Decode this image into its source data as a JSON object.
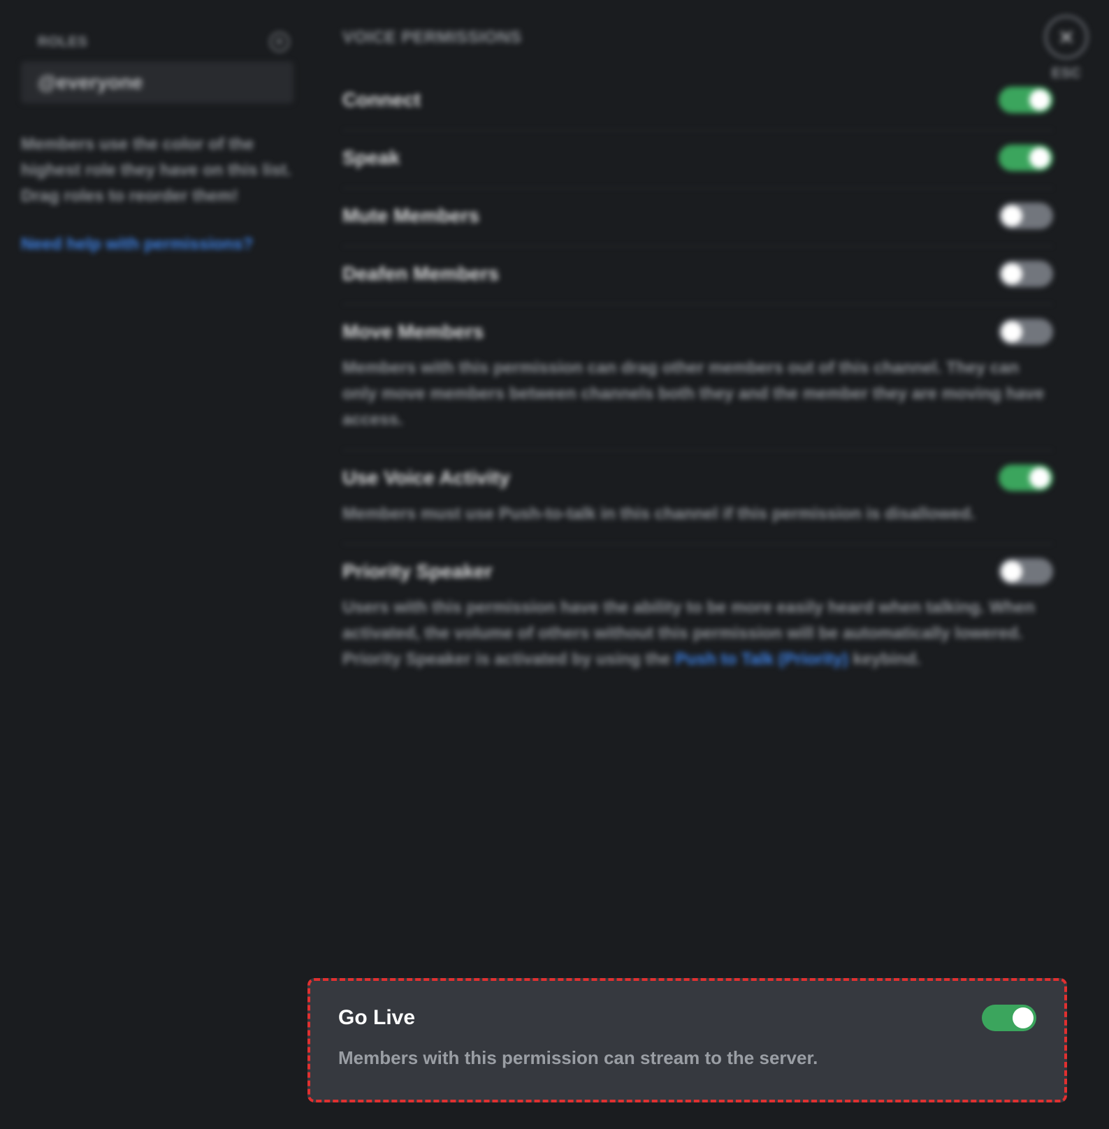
{
  "sidebar": {
    "roles_header": "ROLES",
    "role_pill": "@everyone",
    "description": "Members use the color of the highest role they have on this list. Drag roles to reorder them!",
    "help_link": "Need help with permissions?"
  },
  "close": {
    "esc_label": "ESC"
  },
  "main": {
    "section_title": "VOICE PERMISSIONS",
    "permissions": [
      {
        "key": "connect",
        "title": "Connect",
        "desc": "",
        "enabled": true
      },
      {
        "key": "speak",
        "title": "Speak",
        "desc": "",
        "enabled": true
      },
      {
        "key": "mute_members",
        "title": "Mute Members",
        "desc": "",
        "enabled": false
      },
      {
        "key": "deafen_members",
        "title": "Deafen Members",
        "desc": "",
        "enabled": false
      },
      {
        "key": "move_members",
        "title": "Move Members",
        "desc": "Members with this permission can drag other members out of this channel. They can only move members between channels both they and the member they are moving have access.",
        "enabled": false
      },
      {
        "key": "use_voice_activity",
        "title": "Use Voice Activity",
        "desc": "Members must use Push-to-talk in this channel if this permission is disallowed.",
        "enabled": true
      },
      {
        "key": "priority_speaker",
        "title": "Priority Speaker",
        "desc_before": "Users with this permission have the ability to be more easily heard when talking. When activated, the volume of others without this permission will be automatically lowered. Priority Speaker is activated by using the ",
        "desc_link": "Push to Talk (Priority)",
        "desc_after": " keybind.",
        "enabled": false
      }
    ],
    "highlighted": {
      "key": "go_live",
      "title": "Go Live",
      "desc": "Members with this permission can stream to the server.",
      "enabled": true
    }
  }
}
